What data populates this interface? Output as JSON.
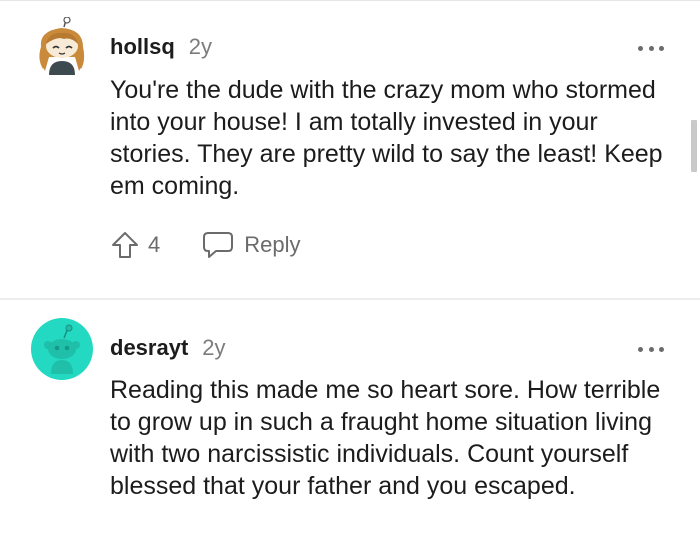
{
  "comments": [
    {
      "username": "hollsq",
      "age": "2y",
      "body": "You're the dude with the crazy mom who stormed into your house! I am totally invested in your stories. They are pretty wild to say the least! Keep em coming.",
      "upvotes": "4",
      "reply_label": "Reply",
      "avatar_icon": "snoo-avatar-hair-icon",
      "avatar_color": "#f2e2c8"
    },
    {
      "username": "desrayt",
      "age": "2y",
      "body": "Reading this made me so heart sore. How terrible to grow up in such a fraught home situation living with two narcissistic individuals. Count yourself blessed that your father and you escaped.",
      "avatar_icon": "snoo-avatar-icon",
      "avatar_color": "#24d9c1"
    }
  ],
  "colors": {
    "text": "#1c1c1c",
    "muted": "#7c7c7c",
    "divider": "#ececec"
  }
}
